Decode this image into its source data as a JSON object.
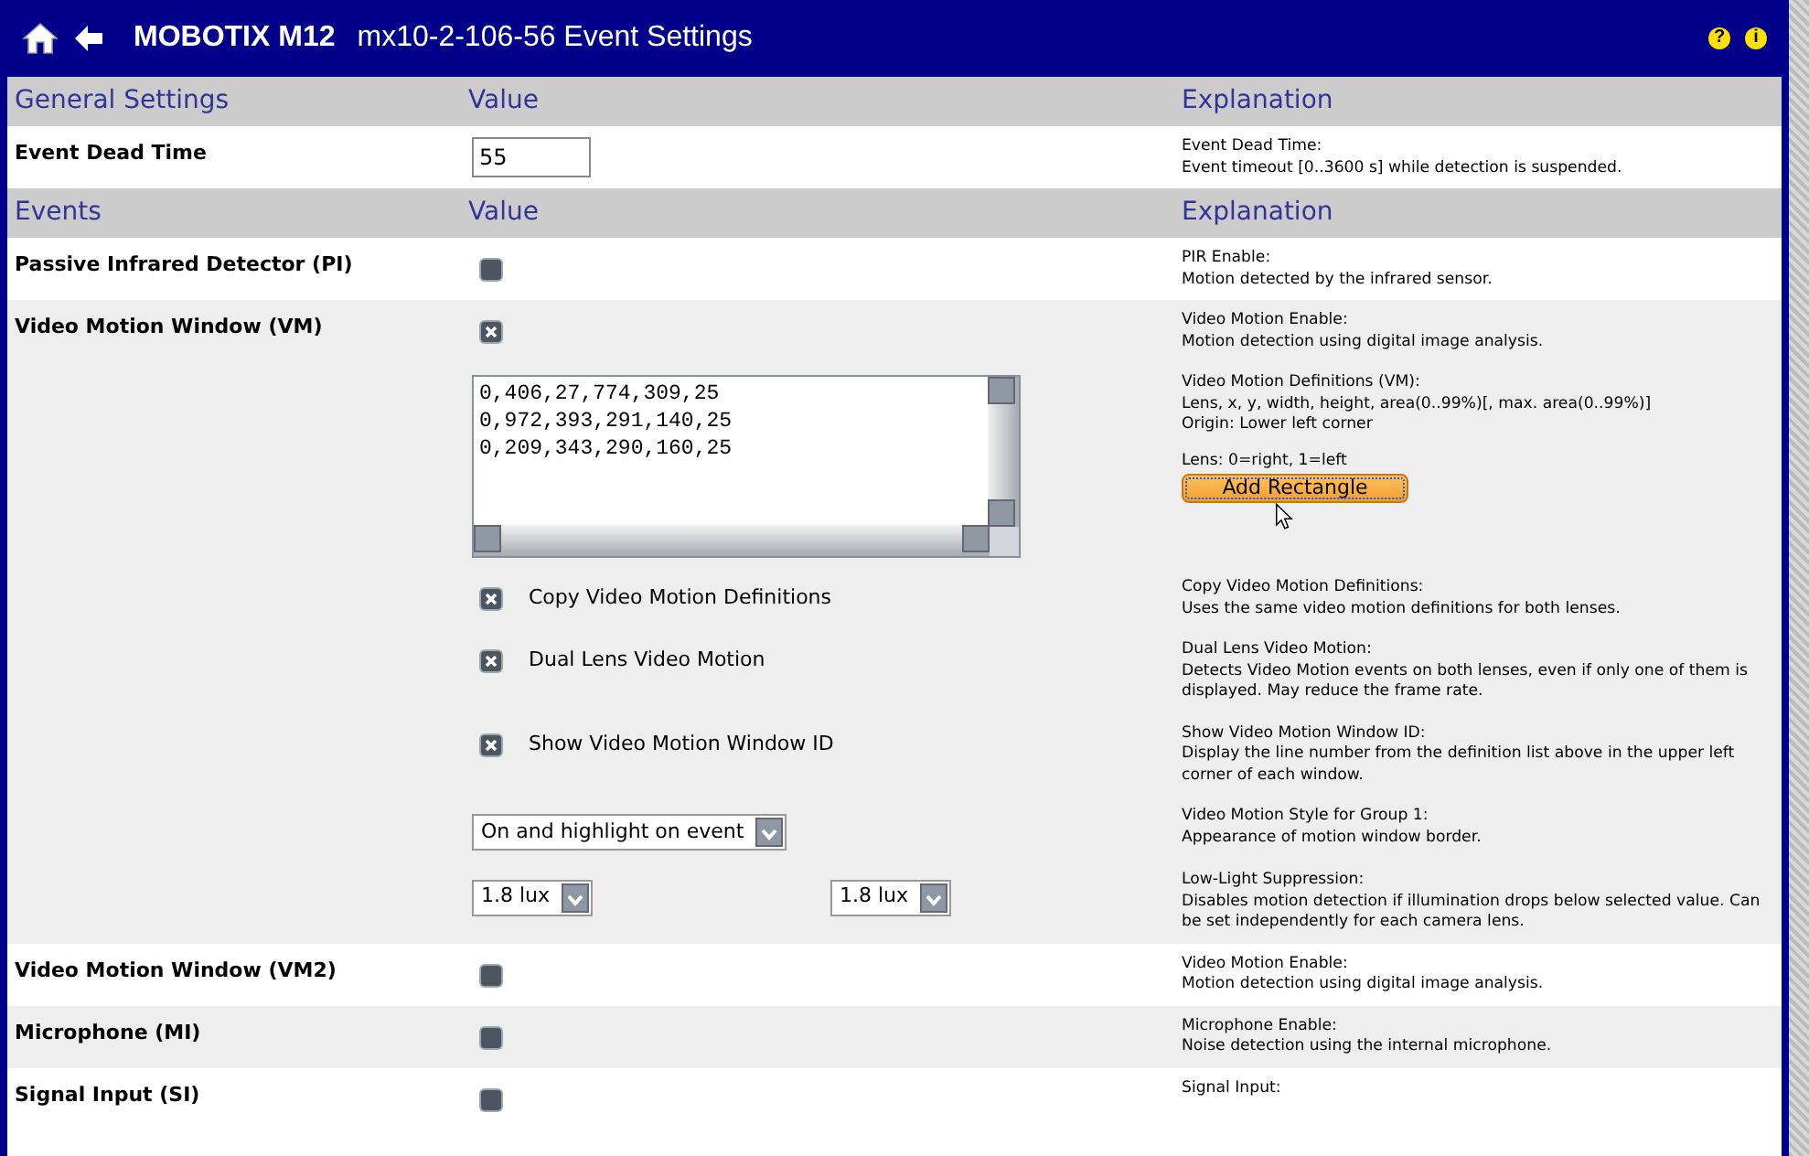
{
  "title_bar": {
    "brand": "MOBOTIX M12",
    "title": "mx10-2-106-56 Event Settings",
    "help": "?",
    "info": "i"
  },
  "sections": [
    {
      "title": "General Settings",
      "value_heading": "Value",
      "explanation_heading": "Explanation",
      "rows": [
        {
          "label": "Event Dead Time",
          "lines": [
            {
              "controls": [
                {
                  "kind": "text_input",
                  "value": "55"
                }
              ],
              "explanation": [
                "Event Dead Time:",
                "Event timeout [0..3600 s] while detection is suspended."
              ]
            }
          ]
        }
      ]
    },
    {
      "title": "Events",
      "value_heading": "Value",
      "explanation_heading": "Explanation",
      "rows": [
        {
          "label": "Passive Infrared Detector (PI)",
          "lines": [
            {
              "controls": [
                {
                  "kind": "checkbox",
                  "checked": false
                }
              ],
              "explanation": [
                "PIR Enable:",
                "Motion detected by the infrared sensor."
              ]
            }
          ]
        },
        {
          "label": "Video Motion Window (VM)",
          "lines": [
            {
              "controls": [
                {
                  "kind": "checkbox",
                  "checked": true
                }
              ],
              "explanation": [
                "Video Motion Enable:",
                "Motion detection using digital image analysis."
              ]
            },
            {
              "controls": [
                {
                  "kind": "textarea",
                  "lines": [
                    "0,406,27,774,309,25",
                    "0,972,393,291,140,25",
                    "0,209,343,290,160,25"
                  ]
                }
              ],
              "explanation": [
                "Video Motion Definitions (VM):",
                "Lens, x, y, width, height, area(0..99%)[, max. area(0..99%)]",
                "Origin: Lower left corner"
              ],
              "note": "Lens: 0=right, 1=left",
              "button": "Add Rectangle"
            },
            {
              "controls": [
                {
                  "kind": "checkbox",
                  "checked": true,
                  "label": "Copy Video Motion Definitions"
                }
              ],
              "explanation": [
                "Copy Video Motion Definitions:",
                "Uses the same video motion definitions for both lenses."
              ]
            },
            {
              "controls": [
                {
                  "kind": "checkbox",
                  "checked": true,
                  "label": "Dual Lens Video Motion"
                }
              ],
              "explanation": [
                "Dual Lens Video Motion:",
                "Detects Video Motion events on both lenses, even if only one of them is displayed. May reduce the frame rate."
              ]
            },
            {
              "controls": [
                {
                  "kind": "checkbox",
                  "checked": true,
                  "label": "Show Video Motion Window ID"
                }
              ],
              "explanation": [
                "Show Video Motion Window ID:",
                "Display the line number from the definition list above in the upper left corner of each window."
              ]
            },
            {
              "controls": [
                {
                  "kind": "select",
                  "value": "On and highlight on event"
                }
              ],
              "explanation": [
                "Video Motion Style for Group 1:",
                "Appearance of motion window border."
              ]
            },
            {
              "controls": [
                {
                  "kind": "select",
                  "value": "1.8 lux"
                },
                {
                  "kind": "select",
                  "value": "1.8 lux"
                }
              ],
              "explanation": [
                "Low-Light Suppression:",
                "Disables motion detection if illumination drops below selected value. Can be set independently for each camera lens."
              ]
            }
          ]
        },
        {
          "label": "Video Motion Window (VM2)",
          "lines": [
            {
              "controls": [
                {
                  "kind": "checkbox",
                  "checked": false
                }
              ],
              "explanation": [
                "Video Motion Enable:",
                "Motion detection using digital image analysis."
              ]
            }
          ]
        },
        {
          "label": "Microphone (MI)",
          "lines": [
            {
              "controls": [
                {
                  "kind": "checkbox",
                  "checked": false
                }
              ],
              "explanation": [
                "Microphone Enable:",
                "Noise detection using the internal microphone."
              ]
            }
          ]
        },
        {
          "label": "Signal Input (SI)",
          "lines": [
            {
              "controls": [
                {
                  "kind": "checkbox",
                  "checked": false
                }
              ],
              "explanation": [
                "Signal Input:"
              ]
            }
          ]
        }
      ]
    }
  ]
}
